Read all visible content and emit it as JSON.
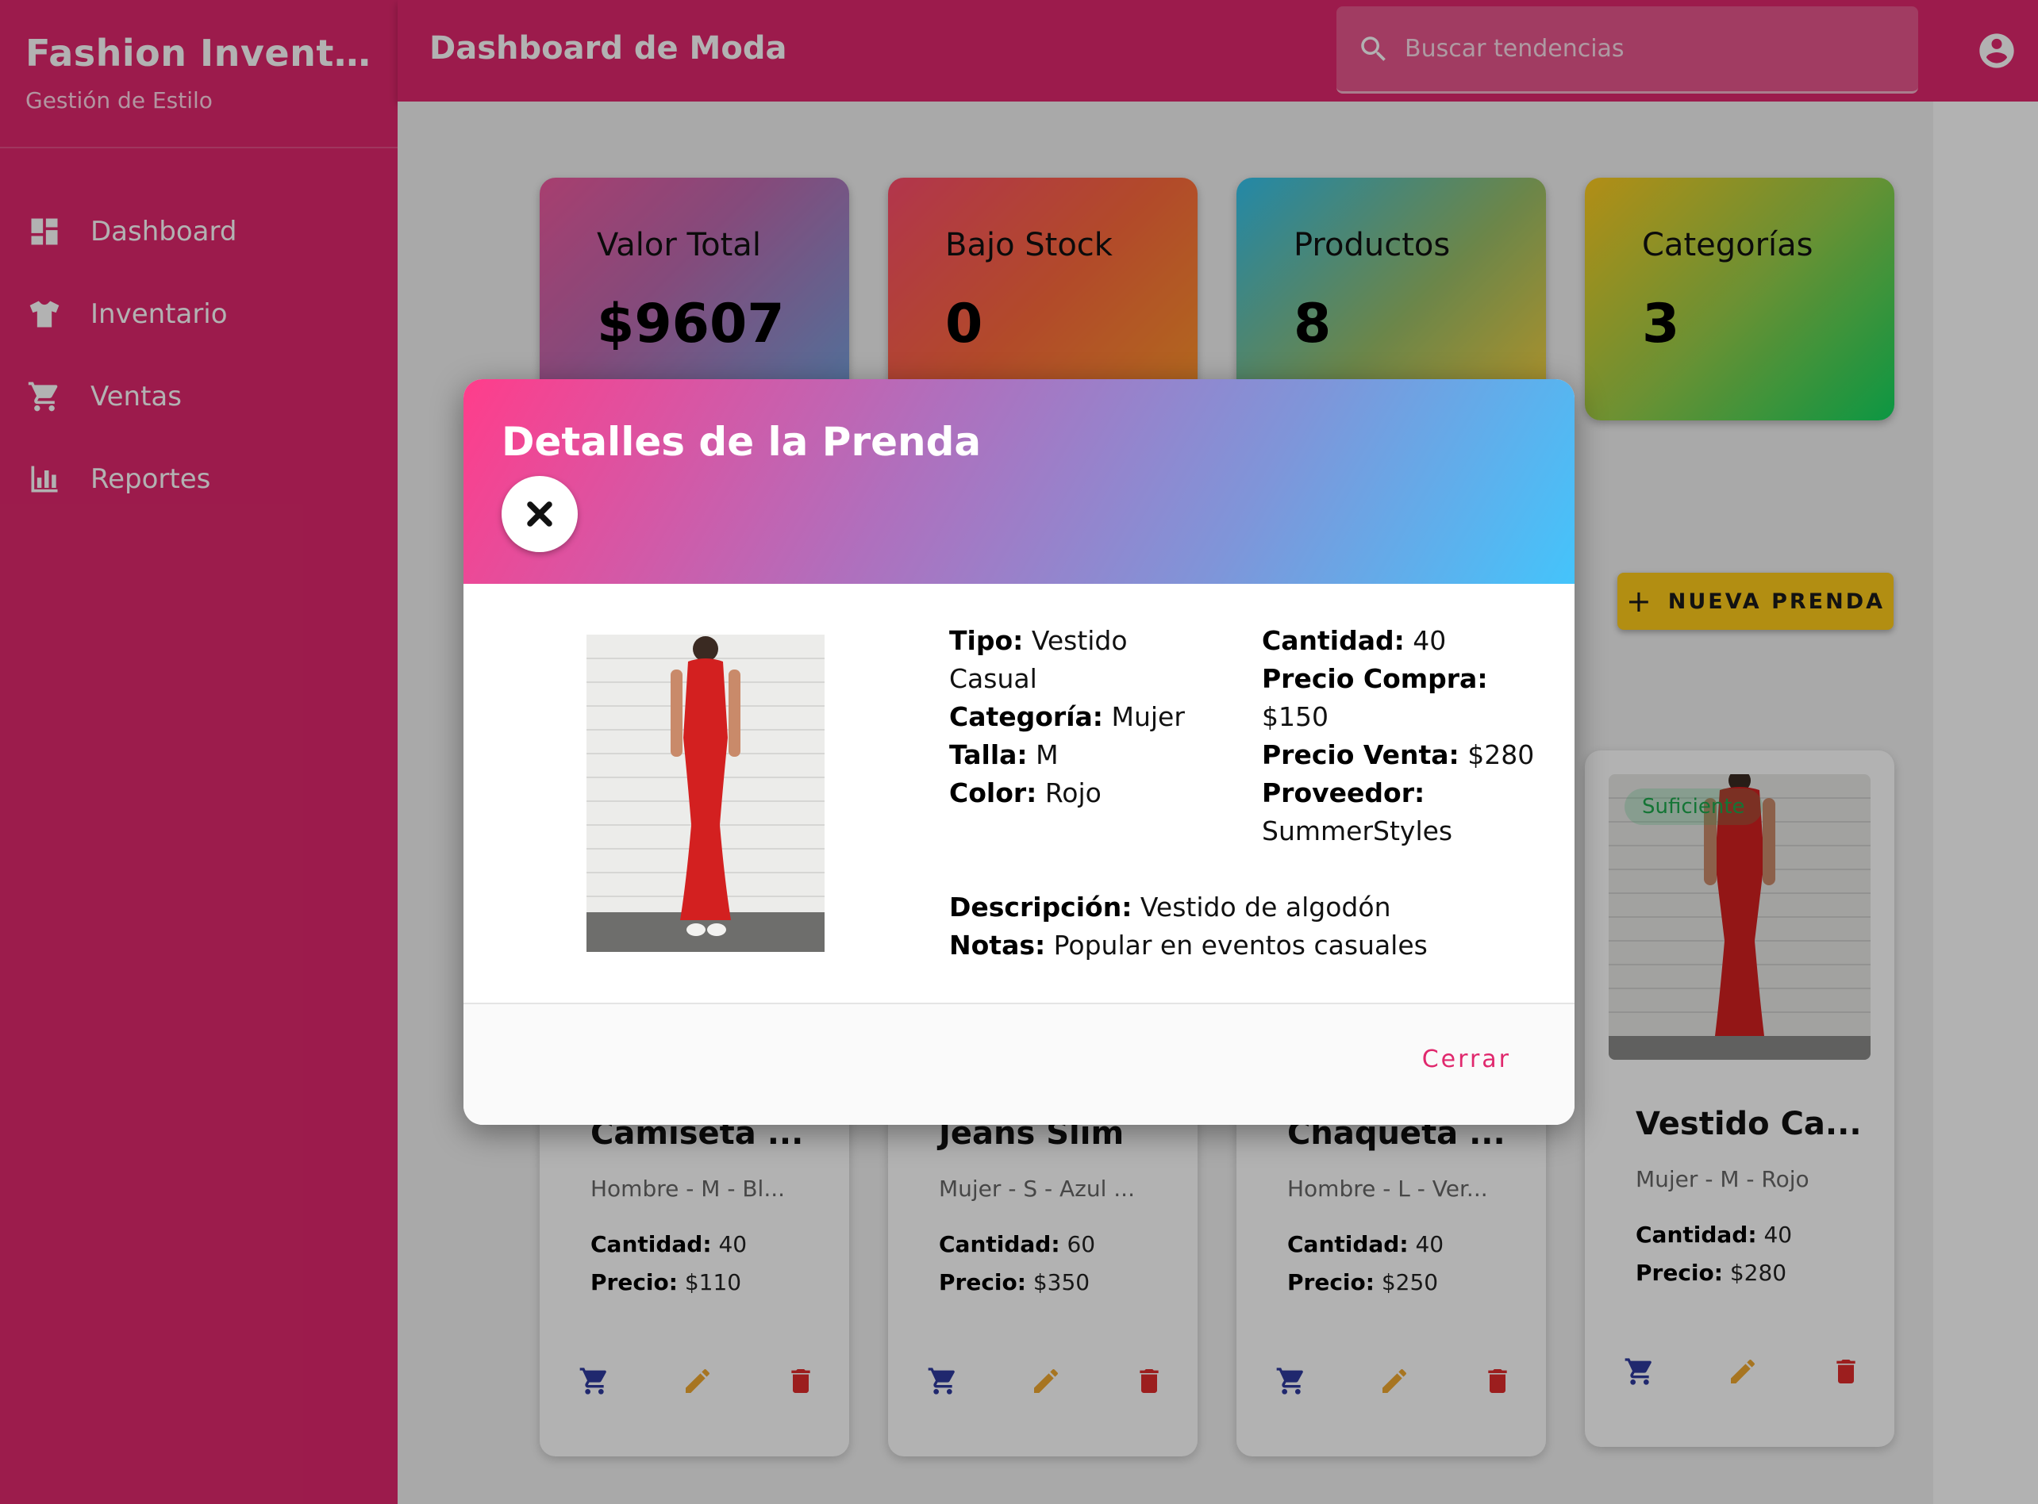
{
  "app": {
    "title": "Fashion Invento...",
    "subtitle": "Gestión de Estilo"
  },
  "nav": [
    {
      "label": "Dashboard",
      "icon": "dashboard-icon"
    },
    {
      "label": "Inventario",
      "icon": "shirt-icon"
    },
    {
      "label": "Ventas",
      "icon": "cart-icon"
    },
    {
      "label": "Reportes",
      "icon": "bar-chart-icon"
    }
  ],
  "header": {
    "title": "Dashboard de Moda",
    "search_placeholder": "Buscar tendencias"
  },
  "stats": [
    {
      "label": "Valor Total",
      "value": "$9607"
    },
    {
      "label": "Bajo Stock",
      "value": "0"
    },
    {
      "label": "Productos",
      "value": "8"
    },
    {
      "label": "Categorías",
      "value": "3"
    }
  ],
  "new_button": {
    "label": "NUEVA PRENDA"
  },
  "products": [
    {
      "title": "Camiseta ...",
      "sub": "Hombre - M - Bl...",
      "qty_label": "Cantidad:",
      "qty": "40",
      "price_label": "Precio:",
      "price": "$110"
    },
    {
      "title": "Jeans Slim",
      "sub": "Mujer - S - Azul ...",
      "qty_label": "Cantidad:",
      "qty": "60",
      "price_label": "Precio:",
      "price": "$350"
    },
    {
      "title": "Chaqueta ...",
      "sub": "Hombre - L - Ver...",
      "qty_label": "Cantidad:",
      "qty": "40",
      "price_label": "Precio:",
      "price": "$250"
    },
    {
      "title": "Vestido Ca...",
      "sub": "Mujer - M - Rojo",
      "qty_label": "Cantidad:",
      "qty": "40",
      "price_label": "Precio:",
      "price": "$280",
      "badge": "Suficiente"
    }
  ],
  "modal": {
    "title": "Detalles de la Prenda",
    "left": [
      {
        "label": "Tipo:",
        "value": "Vestido Casual"
      },
      {
        "label": "Categoría:",
        "value": "Mujer"
      },
      {
        "label": "Talla:",
        "value": "M"
      },
      {
        "label": "Color:",
        "value": "Rojo"
      }
    ],
    "right": [
      {
        "label": "Cantidad:",
        "value": "40"
      },
      {
        "label": "Precio Compra:",
        "value": "$150"
      },
      {
        "label": "Precio Venta:",
        "value": "$280"
      },
      {
        "label": "Proveedor:",
        "value": "SummerStyles"
      }
    ],
    "description_label": "Descripción:",
    "description": "Vestido de algodón",
    "notes_label": "Notas:",
    "notes": "Popular en eventos casuales",
    "close_label": "Cerrar"
  },
  "colors": {
    "primary": "#e0286d",
    "accent": "#ffcc1a",
    "stock_ok": "#1ea84d"
  }
}
